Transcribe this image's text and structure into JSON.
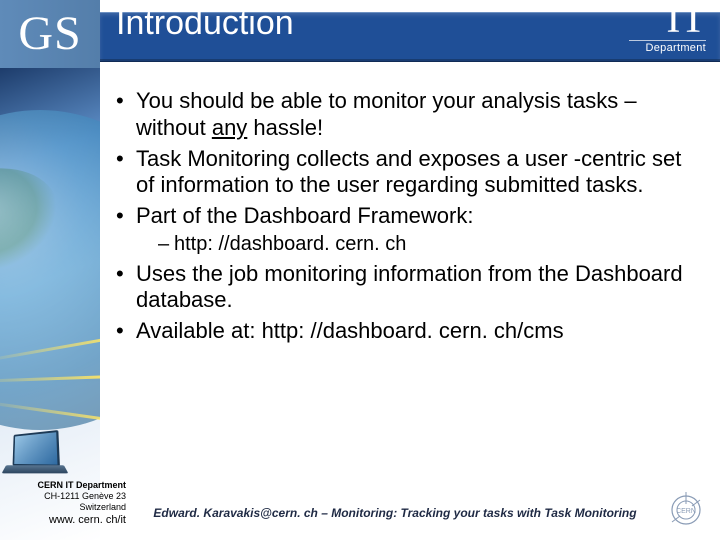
{
  "header": {
    "gs": "GS",
    "title": "Introduction",
    "logo": {
      "org": "CERN",
      "it": "IT",
      "dept": "Department"
    }
  },
  "bullets": {
    "b1_pre": "You should be able to monitor your analysis tasks – without ",
    "b1_underlined": "any",
    "b1_post": " hassle!",
    "b2": "Task Monitoring collects and exposes a user -centric set of information to the user regarding submitted tasks.",
    "b3": "Part of the Dashboard Framework:",
    "b3_sub1": "http: //dashboard. cern. ch",
    "b4": "Uses the job monitoring information from the Dashboard database.",
    "b5": "Available at: http: //dashboard. cern. ch/cms"
  },
  "footer": {
    "addr1": "CERN IT Department",
    "addr2": "CH-1211 Genève 23",
    "addr3": "Switzerland",
    "url": "www. cern. ch/it",
    "caption": "Edward. Karavakis@cern. ch – Monitoring: Tracking your tasks with Task Monitoring"
  }
}
